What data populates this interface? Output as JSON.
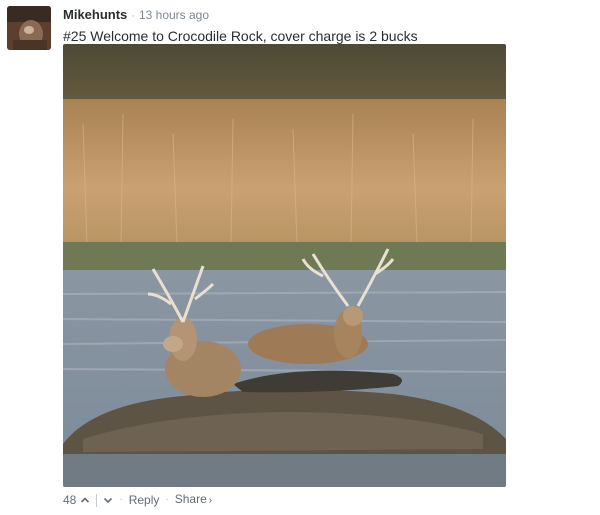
{
  "comment": {
    "author": "Mikehunts",
    "bullet": "·",
    "time_ago": "13 hours ago",
    "text": "#25 Welcome to Crocodile Rock, cover charge is 2 bucks"
  },
  "actions": {
    "upvote_count": "48",
    "dot": "·",
    "reply_label": "Reply",
    "share_label": "Share",
    "share_arrow": "›"
  },
  "photo": {
    "subject": "two stags resting on a crocodile on a mud islet"
  }
}
